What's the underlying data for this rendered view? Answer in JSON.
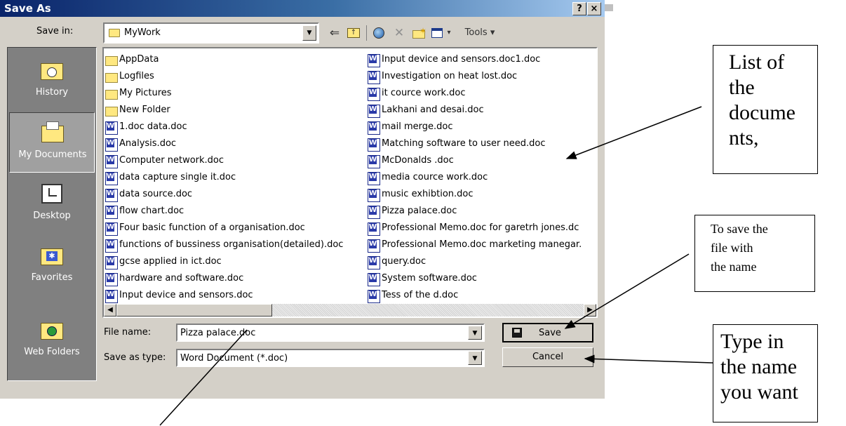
{
  "dialog": {
    "title": "Save As",
    "help_btn": "?",
    "close_btn": "×",
    "save_in_label": "Save in:",
    "save_in_value": "MyWork",
    "tools_label": "Tools ▾",
    "views_arrow": "▾"
  },
  "places": [
    {
      "label": "History"
    },
    {
      "label": "My Documents"
    },
    {
      "label": "Desktop"
    },
    {
      "label": "Favorites"
    },
    {
      "label": "Web Folders"
    }
  ],
  "files_col1": [
    {
      "name": "AppData",
      "type": "folder"
    },
    {
      "name": "Logfiles",
      "type": "folder"
    },
    {
      "name": "My Pictures",
      "type": "folder"
    },
    {
      "name": "New Folder",
      "type": "folder"
    },
    {
      "name": "1.doc data.doc",
      "type": "doc"
    },
    {
      "name": "Analysis.doc",
      "type": "doc"
    },
    {
      "name": "Computer network.doc",
      "type": "doc"
    },
    {
      "name": "data capture single it.doc",
      "type": "doc"
    },
    {
      "name": "data source.doc",
      "type": "doc"
    },
    {
      "name": "flow chart.doc",
      "type": "doc"
    },
    {
      "name": "Four basic function of a organisation.doc",
      "type": "doc"
    },
    {
      "name": "functions of bussiness organisation(detailed).doc",
      "type": "doc"
    },
    {
      "name": "gcse applied in ict.doc",
      "type": "doc"
    },
    {
      "name": "hardware and software.doc",
      "type": "doc"
    },
    {
      "name": "Input device and sensors.doc",
      "type": "doc"
    }
  ],
  "files_col2": [
    {
      "name": "Input device and sensors.doc1.doc",
      "type": "doc"
    },
    {
      "name": "Investigation on heat lost.doc",
      "type": "doc"
    },
    {
      "name": "it cource work.doc",
      "type": "doc"
    },
    {
      "name": "Lakhani and desai.doc",
      "type": "doc"
    },
    {
      "name": "mail merge.doc",
      "type": "doc"
    },
    {
      "name": "Matching software to user need.doc",
      "type": "doc"
    },
    {
      "name": "McDonalds .doc",
      "type": "doc"
    },
    {
      "name": "media cource work.doc",
      "type": "doc"
    },
    {
      "name": "music exhibtion.doc",
      "type": "doc"
    },
    {
      "name": "Pizza palace.doc",
      "type": "doc"
    },
    {
      "name": "Professional Memo.doc for garetrh jones.dc",
      "type": "doc"
    },
    {
      "name": "Professional Memo.doc marketing manegar.",
      "type": "doc"
    },
    {
      "name": "query.doc",
      "type": "doc"
    },
    {
      "name": "System software.doc",
      "type": "doc"
    },
    {
      "name": "Tess of the d.doc",
      "type": "doc"
    }
  ],
  "file_name": {
    "label": "File name:",
    "value": "Pizza palace.doc"
  },
  "save_as_type": {
    "label": "Save as type:",
    "value": "Word Document (*.doc)"
  },
  "buttons": {
    "save": "Save",
    "cancel": "Cancel"
  },
  "annotations": {
    "list_note": [
      "List of",
      "the",
      "docume",
      "nts,"
    ],
    "save_note": [
      "To save the",
      "file with",
      "the name"
    ],
    "type_note": [
      "Type in",
      "the name",
      "you want"
    ]
  }
}
